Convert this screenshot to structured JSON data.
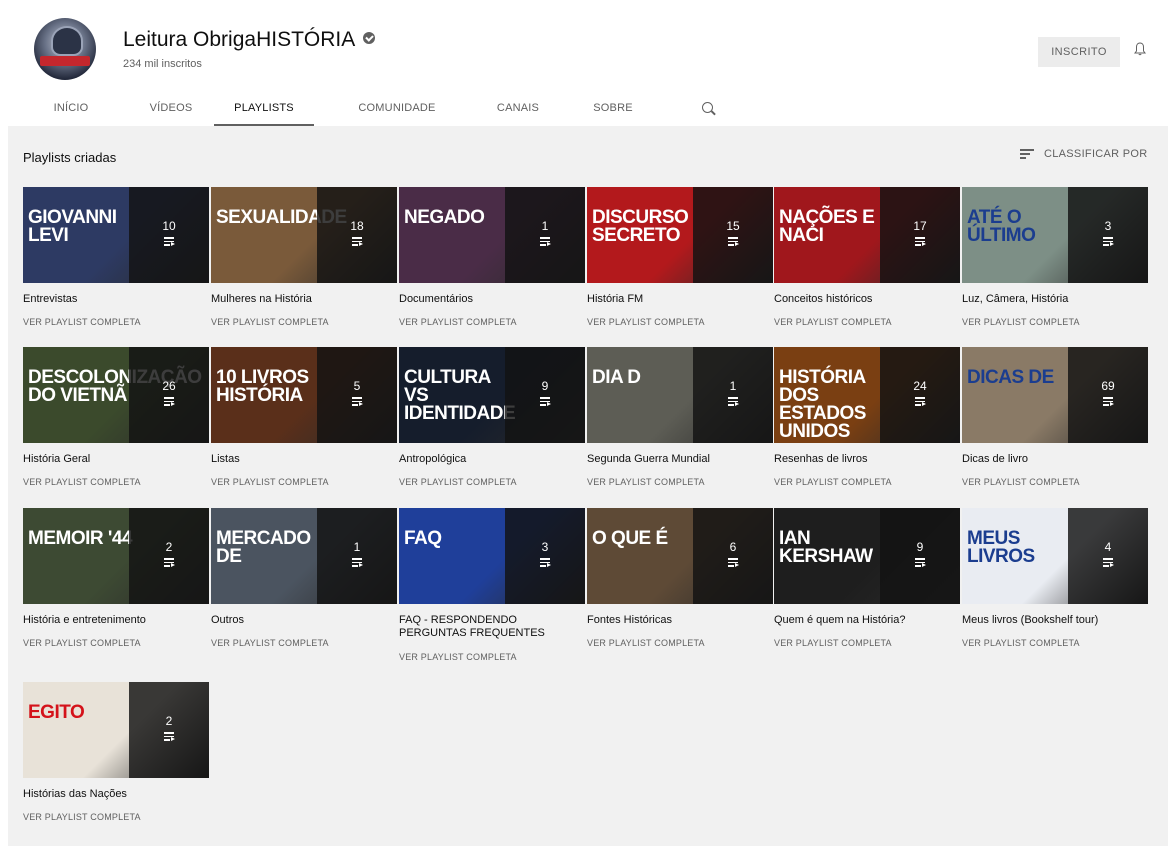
{
  "channel": {
    "name": "Leitura ObrigaHISTÓRIA",
    "subscribers": "234 mil inscritos",
    "subscribe_label": "INSCRITO",
    "verified_icon": "verified-check-icon",
    "bell_icon": "bell-icon"
  },
  "tabs": [
    {
      "label": "INÍCIO"
    },
    {
      "label": "VÍDEOS"
    },
    {
      "label": "PLAYLISTS",
      "active": true
    },
    {
      "label": "COMUNIDADE"
    },
    {
      "label": "CANAIS"
    },
    {
      "label": "SOBRE"
    }
  ],
  "section": {
    "title": "Playlists criadas",
    "sort_label": "CLASSIFICAR POR"
  },
  "playlists": [
    {
      "name": "Entrevistas",
      "count": "10",
      "thumb_text": "GIOVANNI LEVI",
      "color": "#2d3a63",
      "link": "VER PLAYLIST COMPLETA"
    },
    {
      "name": "Mulheres na História",
      "count": "18",
      "thumb_text": "SEXUALIDADE",
      "color": "#7a5a3a",
      "link": "VER PLAYLIST COMPLETA"
    },
    {
      "name": "Documentários",
      "count": "1",
      "thumb_text": "NEGADO",
      "color": "#4a2c47",
      "link": "VER PLAYLIST COMPLETA"
    },
    {
      "name": "História FM",
      "count": "15",
      "thumb_text": "DISCURSO SECRETO",
      "color": "#b3191c",
      "link": "VER PLAYLIST COMPLETA"
    },
    {
      "name": "Conceitos históricos",
      "count": "17",
      "thumb_text": "NAÇÕES E NACI",
      "color": "#a0171c",
      "link": "VER PLAYLIST COMPLETA"
    },
    {
      "name": "Luz, Câmera, História",
      "count": "3",
      "thumb_text": "ATÉ O ÚLTIMO",
      "color": "#7d8f86",
      "link": "VER PLAYLIST COMPLETA"
    },
    {
      "name": "História Geral",
      "count": "26",
      "thumb_text": "DESCOLONIZAÇÃO DO VIETNÃ",
      "color": "#3b4a2c",
      "link": "VER PLAYLIST COMPLETA"
    },
    {
      "name": "Listas",
      "count": "5",
      "thumb_text": "10 LIVROS HISTÓRIA",
      "color": "#5a2f1a",
      "link": "VER PLAYLIST COMPLETA"
    },
    {
      "name": "Antropológica",
      "count": "9",
      "thumb_text": "CULTURA VS IDENTIDADE",
      "color": "#151d2c",
      "link": "VER PLAYLIST COMPLETA"
    },
    {
      "name": "Segunda Guerra Mundial",
      "count": "1",
      "thumb_text": "DIA D",
      "color": "#5d5d55",
      "link": "VER PLAYLIST COMPLETA"
    },
    {
      "name": "Resenhas de livros",
      "count": "24",
      "thumb_text": "HISTÓRIA DOS ESTADOS UNIDOS",
      "color": "#7a3f12",
      "link": "VER PLAYLIST COMPLETA"
    },
    {
      "name": "Dicas de livro",
      "count": "69",
      "thumb_text": "DICAS DE",
      "color": "#8a7a66",
      "link": "VER PLAYLIST COMPLETA"
    },
    {
      "name": "História e entretenimento",
      "count": "2",
      "thumb_text": "MEMOIR '44",
      "color": "#3d4a33",
      "link": "VER PLAYLIST COMPLETA"
    },
    {
      "name": "Outros",
      "count": "1",
      "thumb_text": "MERCADO DE",
      "color": "#4b5460",
      "link": "VER PLAYLIST COMPLETA"
    },
    {
      "name": "FAQ - RESPONDENDO PERGUNTAS FREQUENTES",
      "count": "3",
      "thumb_text": "FAQ",
      "color": "#1f3f9a",
      "link": "VER PLAYLIST COMPLETA"
    },
    {
      "name": "Fontes Históricas",
      "count": "6",
      "thumb_text": "O QUE É",
      "color": "#5e4a36",
      "link": "VER PLAYLIST COMPLETA"
    },
    {
      "name": "Quem é quem na História?",
      "count": "9",
      "thumb_text": "IAN KERSHAW",
      "color": "#1e1e1e",
      "link": "VER PLAYLIST COMPLETA"
    },
    {
      "name": "Meus livros (Bookshelf tour)",
      "count": "4",
      "thumb_text": "MEUS LIVROS",
      "color": "#e9ecf2",
      "link": "VER PLAYLIST COMPLETA"
    },
    {
      "name": "Histórias das Nações",
      "count": "2",
      "thumb_text": "EGITO",
      "color": "#e8e2d8",
      "link": "VER PLAYLIST COMPLETA"
    }
  ]
}
